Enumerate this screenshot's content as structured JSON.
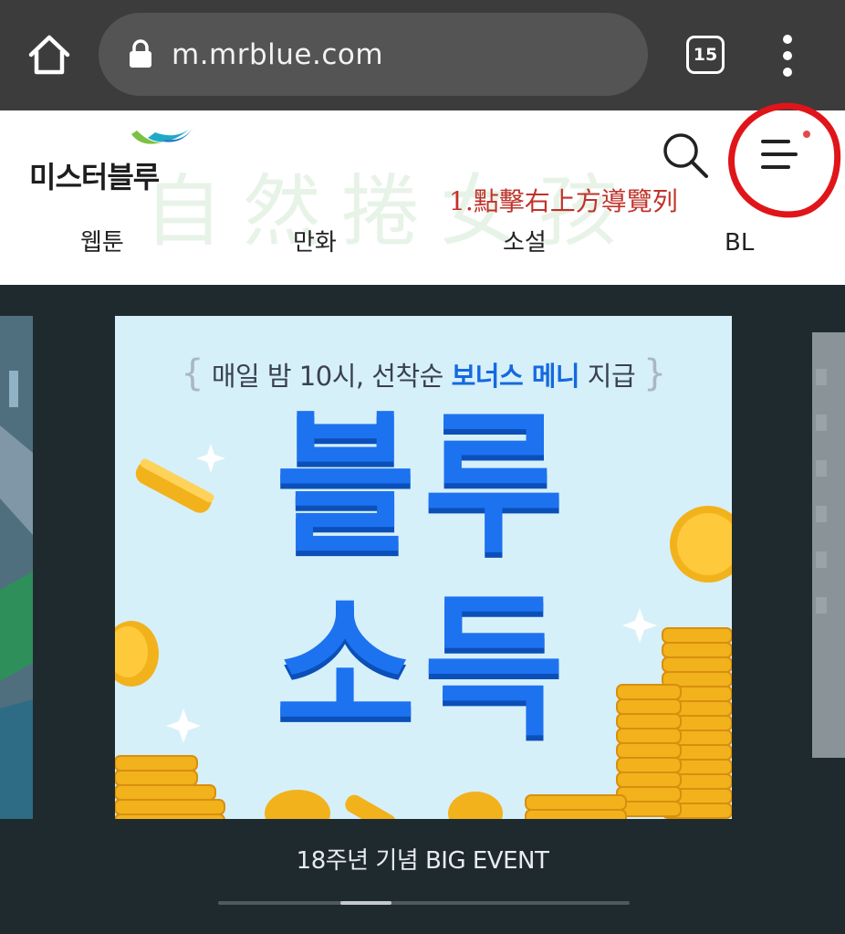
{
  "browser": {
    "url": "m.mrblue.com",
    "tab_count": "15"
  },
  "header": {
    "logo_text": "미스터블루",
    "watermark": "自然捲女孩",
    "annotation": "1.點擊右上方導覽列"
  },
  "nav": {
    "tabs": [
      {
        "label": "웹툰"
      },
      {
        "label": "만화"
      },
      {
        "label": "소설"
      },
      {
        "label": "BL"
      }
    ]
  },
  "banner": {
    "sub_prefix": "매일 밤 10시, 선착순",
    "sub_highlight": "보너스 메니",
    "sub_suffix": "지급",
    "title_line1": "블루",
    "title_line2": "소득",
    "caption": "18주년 기념 BIG EVENT"
  },
  "carousel": {
    "progress_fraction": 0.36
  },
  "colors": {
    "browser_bg": "#3c3c3c",
    "url_bar": "#545454",
    "carousel_bg": "#1f2a2e",
    "banner_bg": "#d6f0fa",
    "accent_blue": "#1d72f0",
    "annotation_red": "#e0151a"
  }
}
